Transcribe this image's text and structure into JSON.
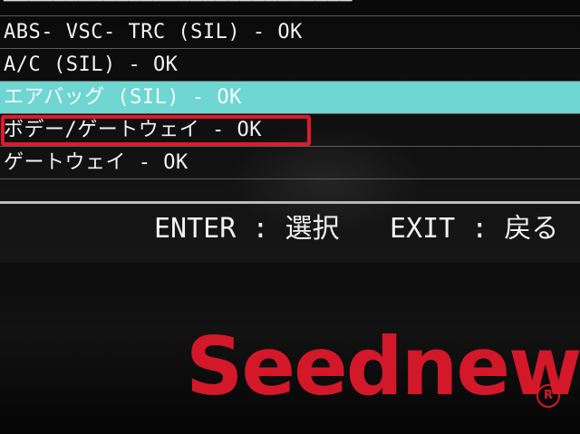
{
  "menu": {
    "items": [
      {
        "label": "ABS- VSC- TRC (SIL)  - OK"
      },
      {
        "label": "A/C (SIL)  - OK"
      },
      {
        "label": "エアバッグ (SIL)  - OK"
      },
      {
        "label": "ボデー/ゲートウェイ - OK"
      },
      {
        "label": "ゲートウェイ - OK"
      }
    ],
    "selected_index": 2,
    "highlighted_index": 3
  },
  "footer": {
    "enter_hint": "ENTER : 選択",
    "exit_hint": "EXIT : 戻る"
  },
  "brand": {
    "logo_text": "Seednew",
    "registered_mark": "R",
    "logo_color": "#d3182a"
  },
  "colors": {
    "selection_bg": "#6fd6d2",
    "highlight_border": "#e0192b",
    "text": "#f2f2f2"
  }
}
